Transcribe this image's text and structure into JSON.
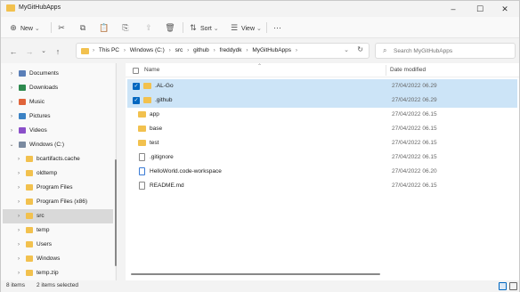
{
  "window": {
    "title": "MyGitHubApps"
  },
  "commandbar": {
    "new_label": "New",
    "sort_label": "Sort",
    "view_label": "View",
    "more_label": "···"
  },
  "address": {
    "crumbs": [
      "This PC",
      "Windows (C:)",
      "src",
      "github",
      "freddydk",
      "MyGitHubApps"
    ]
  },
  "search": {
    "placeholder": "Search MyGitHubApps"
  },
  "nav": {
    "items": [
      {
        "label": "Documents",
        "icon": "documents-icon",
        "color": "#5a7fb8"
      },
      {
        "label": "Downloads",
        "icon": "download-icon",
        "color": "#2d8a4e"
      },
      {
        "label": "Music",
        "icon": "music-icon",
        "color": "#e0643a"
      },
      {
        "label": "Pictures",
        "icon": "pictures-icon",
        "color": "#3b82c4"
      },
      {
        "label": "Videos",
        "icon": "videos-icon",
        "color": "#8a4fc9"
      },
      {
        "label": "Windows (C:)",
        "icon": "drive-icon",
        "color": "#7a8aa0"
      },
      {
        "label": "bcartifacts.cache",
        "icon": "folder-icon",
        "color": "#f2c14e"
      },
      {
        "label": "oldtemp",
        "icon": "folder-icon",
        "color": "#f2c14e"
      },
      {
        "label": "Program Files",
        "icon": "folder-icon",
        "color": "#f2c14e"
      },
      {
        "label": "Program Files (x86)",
        "icon": "folder-icon",
        "color": "#f2c14e"
      },
      {
        "label": "src",
        "icon": "folder-icon",
        "color": "#f2c14e"
      },
      {
        "label": "temp",
        "icon": "folder-icon",
        "color": "#f2c14e"
      },
      {
        "label": "Users",
        "icon": "folder-icon",
        "color": "#f2c14e"
      },
      {
        "label": "Windows",
        "icon": "folder-icon",
        "color": "#f2c14e"
      },
      {
        "label": "temp.zip",
        "icon": "zip-icon",
        "color": "#f2c14e"
      }
    ],
    "selected": "src"
  },
  "columns": {
    "name": "Name",
    "date": "Date modified"
  },
  "files": [
    {
      "name": ".AL-Go",
      "date": "27/04/2022 06.29",
      "type": "folder",
      "selected": true
    },
    {
      "name": ".github",
      "date": "27/04/2022 06.29",
      "type": "folder",
      "selected": true
    },
    {
      "name": "app",
      "date": "27/04/2022 06.15",
      "type": "folder",
      "selected": false
    },
    {
      "name": "base",
      "date": "27/04/2022 06.15",
      "type": "folder",
      "selected": false
    },
    {
      "name": "test",
      "date": "27/04/2022 06.15",
      "type": "folder",
      "selected": false
    },
    {
      "name": ".gitignore",
      "date": "27/04/2022 06.15",
      "type": "file",
      "selected": false
    },
    {
      "name": "HelloWorld.code-workspace",
      "date": "27/04/2022 06.20",
      "type": "vsfile",
      "selected": false
    },
    {
      "name": "README.md",
      "date": "27/04/2022 06.15",
      "type": "file",
      "selected": false
    }
  ],
  "status": {
    "count": "8 items",
    "selected": "2 items selected"
  },
  "colors": {
    "accent": "#0067c0",
    "selection": "#cce4f7",
    "folder": "#f2c14e"
  }
}
